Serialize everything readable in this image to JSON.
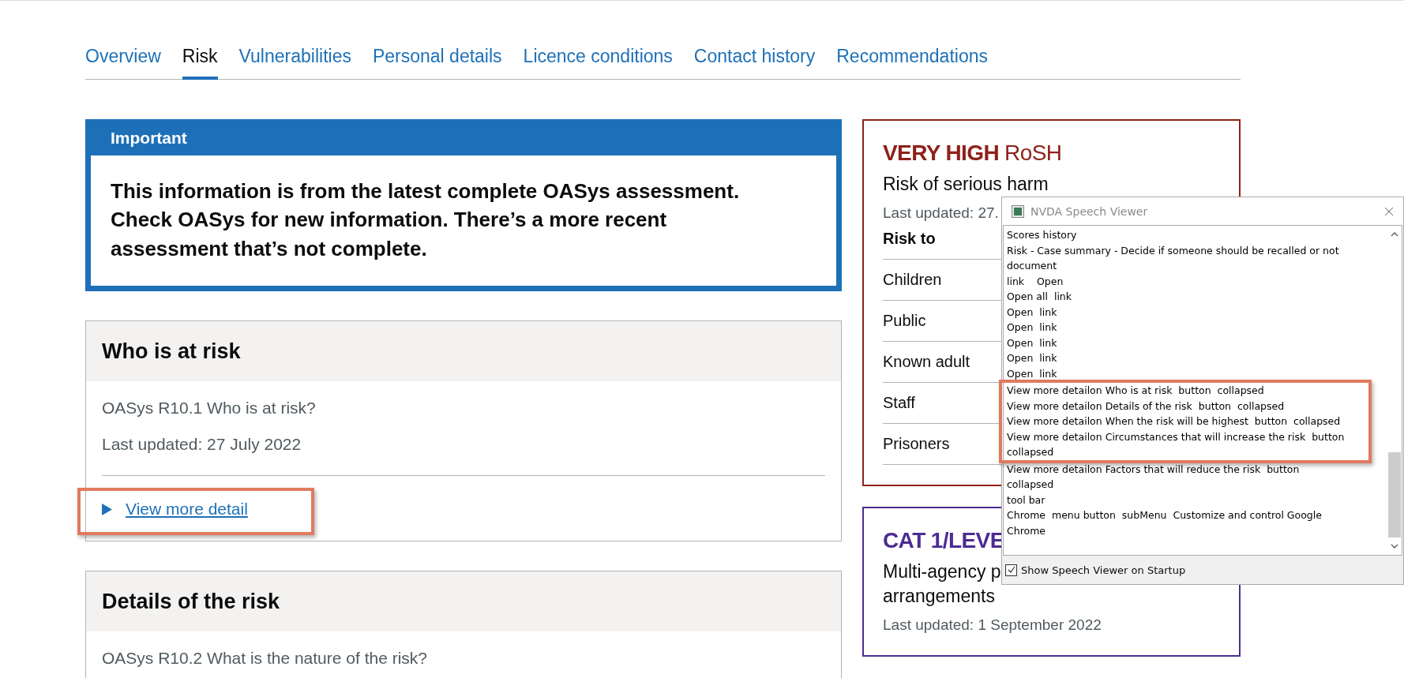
{
  "tabs": [
    {
      "label": "Overview",
      "selected": false
    },
    {
      "label": "Risk",
      "selected": true
    },
    {
      "label": "Vulnerabilities",
      "selected": false
    },
    {
      "label": "Personal details",
      "selected": false
    },
    {
      "label": "Licence conditions",
      "selected": false
    },
    {
      "label": "Contact history",
      "selected": false
    },
    {
      "label": "Recommendations",
      "selected": false
    }
  ],
  "important_banner": {
    "heading": "Important",
    "text": "This information is from the latest complete OASys assessment. Check OASys for new information. There’s a more recent assessment that’s not complete."
  },
  "sections": [
    {
      "heading": "Who is at risk",
      "question": "OASys R10.1 Who is at risk?",
      "last_updated": "Last updated: 27 July 2022",
      "link": "View more detail",
      "highlighted": true
    },
    {
      "heading": "Details of the risk",
      "question": "OASys R10.2 What is the nature of the risk?"
    }
  ],
  "summary_cards": [
    {
      "kind": "rosh",
      "color": "#8e2119",
      "level": "VERY HIGH",
      "suffix": "RoSH",
      "subtitle_lines": [
        "Risk of serious harm"
      ],
      "last_updated": "Last updated: 27.",
      "table": {
        "columns": [
          "Risk to"
        ],
        "rows": [
          "Children",
          "Public",
          "Known adult",
          "Staff",
          "Prisoners"
        ]
      }
    },
    {
      "kind": "mappa",
      "color": "#4c2c92",
      "level": "CAT 1/LEVE",
      "subtitle_lines": [
        "Multi-agency p",
        "arrangements"
      ],
      "last_updated": "Last updated: 1 September 2022"
    }
  ],
  "speech_viewer": {
    "title": "NVDA Speech Viewer",
    "line_groups": [
      {
        "highlighted": false,
        "lines": [
          "Scores history",
          "Risk - Case summary - Decide if someone should be recalled or not document",
          "link    Open",
          "Open all  link",
          "Open  link",
          "Open  link",
          "Open  link",
          "Open  link",
          "Open  link"
        ]
      },
      {
        "highlighted": true,
        "lines": [
          "View more detailon Who is at risk  button  collapsed",
          "View more detailon Details of the risk  button  collapsed",
          "View more detailon When the risk will be highest  button  collapsed",
          "View more detailon Circumstances that will increase the risk  button collapsed"
        ]
      },
      {
        "highlighted": false,
        "lines": [
          "View more detailon Factors that will reduce the risk  button collapsed",
          "tool bar",
          "Chrome  menu button  subMenu  Customize and control Google Chrome"
        ]
      }
    ],
    "startup_checkbox": {
      "label": "Show Speech Viewer on Startup",
      "checked": true
    }
  }
}
